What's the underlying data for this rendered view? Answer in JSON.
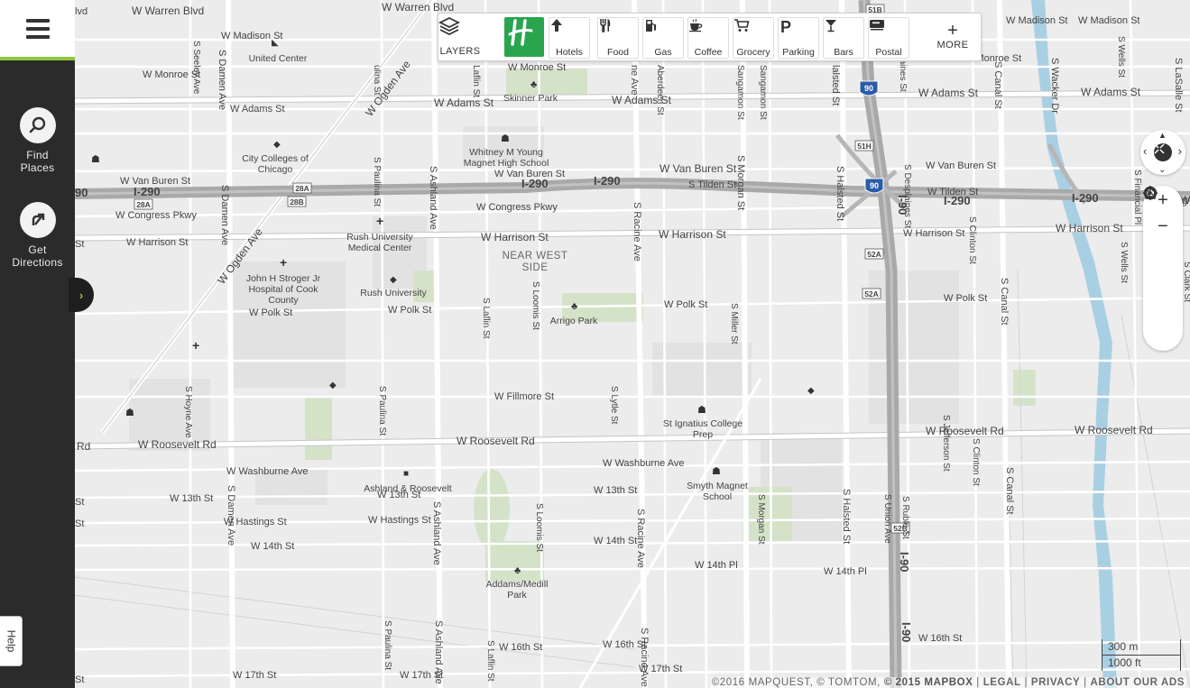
{
  "sidebar": {
    "find": {
      "line1": "Find",
      "line2": "Places"
    },
    "directions": {
      "line1": "Get",
      "line2": "Directions"
    },
    "help": "Help"
  },
  "toolbar": {
    "layers": "LAYERS",
    "categories": [
      {
        "label": "Hotels",
        "icon": "hotel-icon"
      },
      {
        "label": "Food",
        "icon": "fork-knife-icon"
      },
      {
        "label": "Gas",
        "icon": "gas-pump-icon"
      },
      {
        "label": "Coffee",
        "icon": "coffee-cup-icon"
      },
      {
        "label": "Grocery",
        "icon": "shopping-cart-icon"
      },
      {
        "label": "Parking",
        "icon": "parking-icon"
      },
      {
        "label": "Bars",
        "icon": "cocktail-icon"
      },
      {
        "label": "Postal",
        "icon": "mailbox-icon"
      }
    ],
    "more_symbol": "+",
    "more": "MORE"
  },
  "map": {
    "streets": {
      "warren": "W Warren Blvd",
      "madison": "W Madison St",
      "madison_e1": "W Madison St",
      "madison_e2": "W Madison St",
      "monroe": "W Monroe St",
      "monroe_c": "W Monroe St",
      "monroe_e": "W Monroe St",
      "adams_w": "W Adams St",
      "adams_c": "W Adams St",
      "adams_c2": "W Adams St",
      "adams_e1": "W Adams St",
      "adams_e2": "W Adams St",
      "vanburen_w": "W Van Buren St",
      "vanburen_c": "W Van Buren St",
      "vanburen_c2": "W Van Buren St",
      "vanburen_e": "W Van Buren St",
      "tilden": "S Tilden St",
      "tilden_e": "W Tilden St",
      "congress_w": "W Congress Pkwy",
      "congress_c": "W Congress Pkwy",
      "harrison_w": "W Harrison St",
      "harrison_c": "W Harrison St",
      "harrison_c2": "W Harrison St",
      "harrison_e1": "W Harrison St",
      "harrison_e2": "W Harrison St",
      "polk_w": "W Polk St",
      "polk_c": "W Polk St",
      "polk_c2": "W Polk St",
      "polk_e": "W Polk St",
      "fillmore": "W Fillmore St",
      "roosevelt_w0": "Rd",
      "roosevelt_w": "W Roosevelt Rd",
      "roosevelt_c": "W Roosevelt Rd",
      "roosevelt_e1": "W Roosevelt Rd",
      "roosevelt_e2": "W Roosevelt Rd",
      "washburne_w": "W Washburne Ave",
      "washburne_c": "W Washburne Ave",
      "thirteenth_w": "W 13th St",
      "thirteenth_c": "W 13th St",
      "thirteenth_c2": "W 13th St",
      "hastings_w": "W Hastings St",
      "hastings_c": "W Hastings St",
      "fourteenth_w": "W 14th St",
      "fourteenth_c": "W 14th St",
      "fourteenth_pl": "W 14th Pl",
      "fourteenth_pl2": "W 14th Pl",
      "sixteenth_c": "W 16th St",
      "sixteenth_c2": "W 16th St",
      "sixteenth_e": "W 16th St",
      "seventeenth_w": "W 17th St",
      "seventeenth_c": "W 17th St",
      "seventeenth_c2": "W 17th St",
      "ogden_n": "W Ogden Ave",
      "ogden_s": "W Ogden Ave",
      "damen_n": "S Damen Ave",
      "damen_c": "S Damen Ave",
      "damen_s": "S Damen Ave",
      "seeley": "S Seeley Ave",
      "hoyne": "S Hoyne Ave",
      "paulina_n": "S Paulina St",
      "paulina_c": "S Paulina St",
      "paulina_s": "S Paulina St",
      "paulina_top": "ulina St",
      "ashland_n": "S Ashland Ave",
      "ashland_c": "S Ashland Ave",
      "ashland_s": "S Ashland Ave",
      "laflin_n": "Laflin St",
      "laflin_c": "S Laflin St",
      "laflin_s": "S Laflin St",
      "loomis_c": "S Loomis St",
      "loomis_s": "S Loomis St",
      "racine_n": "S Racine Ave",
      "racine_s": "S Racine Ave",
      "racine_s2": "S Racine Ave",
      "racine_top": "ne Ave",
      "aberdeen": "Aberdeen St",
      "lytle": "S Lytle St",
      "morgan_n": "S Morgan St",
      "morgan_s": "S Morgan St",
      "sangamon": "Sangamon St",
      "miller": "S Miller St",
      "halsted_n": "S Halsted St",
      "halsted_top": "lalsted St",
      "halsted_s": "S Halsted St",
      "desplaines_n": "S Desplaines St",
      "desplaines_top": "N Desplaines St",
      "union": "S Union Ave",
      "clinton_n": "S Clinton St",
      "clinton_s": "S Clinton St",
      "jefferson": "S Jefferson St",
      "ruble": "S Ruble St",
      "canal_n": "S Canal St",
      "canal_c": "S Canal St",
      "canal_s": "S Canal St",
      "wacker": "S Wacker Dr",
      "lasalle": "S LaSalle St",
      "wells_n": "S Wells St",
      "wells_s": "S Wells St",
      "financial": "S Financial Pl",
      "clark": "S Clark St",
      "i290_w": "I-290",
      "i290_c": "I-290",
      "i290_c2": "I-290",
      "i290_e1": "I-290",
      "i290_e2": "I-290",
      "i90_n": "I-90",
      "i90_s": "I-90",
      "i90_s2": "I-90",
      "left_frag1": "lvd",
      "left_frag2": "St",
      "left_frag3": "St",
      "left_frag4": "St",
      "left_frag5": "St",
      "left_frag6": "90",
      "east_frag": "W Cong",
      "wells_frag": "W"
    },
    "exits": {
      "e28a1": "28A",
      "e28a2": "28A",
      "e28b": "28B",
      "e51h": "51H",
      "e51b": "51B",
      "e52a1": "52A",
      "e52a2": "52A",
      "e52b": "52B",
      "sh90a": "90",
      "sh90b": "90"
    },
    "places": {
      "united_center": "United Center",
      "ccc1": "City Colleges of",
      "ccc2": "Chicago",
      "skinner": "Skinner Park",
      "whitney1": "Whitney M Young",
      "whitney2": "Magnet High School",
      "rush_med1": "Rush University",
      "rush_med2": "Medical Center",
      "near_west1": "NEAR WEST",
      "near_west2": "SIDE",
      "stroger1": "John H Stroger Jr",
      "stroger2": "Hospital of Cook",
      "stroger3": "County",
      "rush_univ": "Rush University",
      "arrigo": "Arrigo Park",
      "ignatius1": "St Ignatius College",
      "ignatius2": "Prep",
      "ashland_roosevelt": "Ashland & Roosevelt",
      "smyth1": "Smyth Magnet",
      "smyth2": "School",
      "addams1": "Addams/Medill",
      "addams2": "Park"
    }
  },
  "scale": {
    "metric": "300 m",
    "imperial": "1000 ft"
  },
  "attribution": {
    "text": "©2016 MAPQUEST, © TOMTOM, ",
    "mapbox": "© 2015 MAPBOX",
    "sep1": " | ",
    "legal": "LEGAL",
    "sep2": " | ",
    "privacy": "PRIVACY",
    "sep3": " | ",
    "ads": "ABOUT OUR ADS"
  },
  "colors": {
    "brand_green": "#8cc63f",
    "hotel_brand": "#2aa44e",
    "sidebar": "#2b2b2b",
    "river": "#a9cfe3",
    "park": "#cfe0c3",
    "highway": "#b9b9b9"
  }
}
